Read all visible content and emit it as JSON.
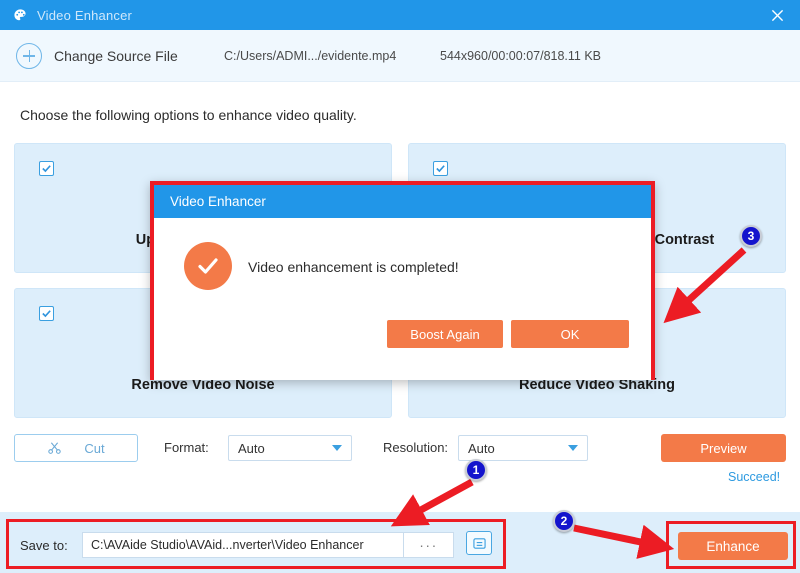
{
  "window": {
    "title": "Video Enhancer",
    "app_icon": "palette-icon",
    "close_icon": "close-icon",
    "titlebar_color": "#2196e8"
  },
  "source_bar": {
    "add_icon": "plus-circle-icon",
    "change_source_label": "Change Source File",
    "file_path": "C:/Users/ADMI.../evidente.mp4",
    "file_meta": "544x960/00:00:07/818.11 KB"
  },
  "instruction": "Choose the following options to enhance video quality.",
  "cards": [
    {
      "label": "Upscale Resolution",
      "checked": true,
      "icon": "upscale-icon"
    },
    {
      "label": "Optimize Brightness and Contrast",
      "checked": true,
      "icon": "brightness-icon"
    },
    {
      "label": "Remove Video Noise",
      "checked": true,
      "icon": "noise-icon"
    },
    {
      "label": "Reduce Video Shaking",
      "checked": true,
      "icon": "shaking-icon"
    }
  ],
  "card_labels_visible": {
    "card1_visible": "Up",
    "card2_visible": "Contrast",
    "card3_visible": "Rem",
    "card4_visible": "king"
  },
  "controls": {
    "cut_label": "Cut",
    "cut_icon": "scissors-icon",
    "format_label": "Format:",
    "format_value": "Auto",
    "resolution_label": "Resolution:",
    "resolution_value": "Auto",
    "preview_label": "Preview",
    "succeed_label": "Succeed!"
  },
  "save_bar": {
    "save_to_label": "Save to:",
    "path_value": "C:\\AVAide Studio\\AVAid...nverter\\Video Enhancer",
    "browse_label": "···",
    "folder_icon": "open-folder-icon",
    "enhance_label": "Enhance"
  },
  "modal": {
    "title": "Video Enhancer",
    "status_icon": "check-circle-icon",
    "message": "Video enhancement is completed!",
    "boost_again_label": "Boost Again",
    "ok_label": "OK"
  },
  "annotations": {
    "badges": [
      "1",
      "2",
      "3"
    ],
    "highlight_color": "#ec1c24",
    "badge_color": "#1414cd"
  },
  "colors": {
    "accent_blue": "#2196e8",
    "accent_orange": "#f37a48",
    "card_bg": "#ddeefb",
    "header_bg": "#f0f8fe"
  }
}
